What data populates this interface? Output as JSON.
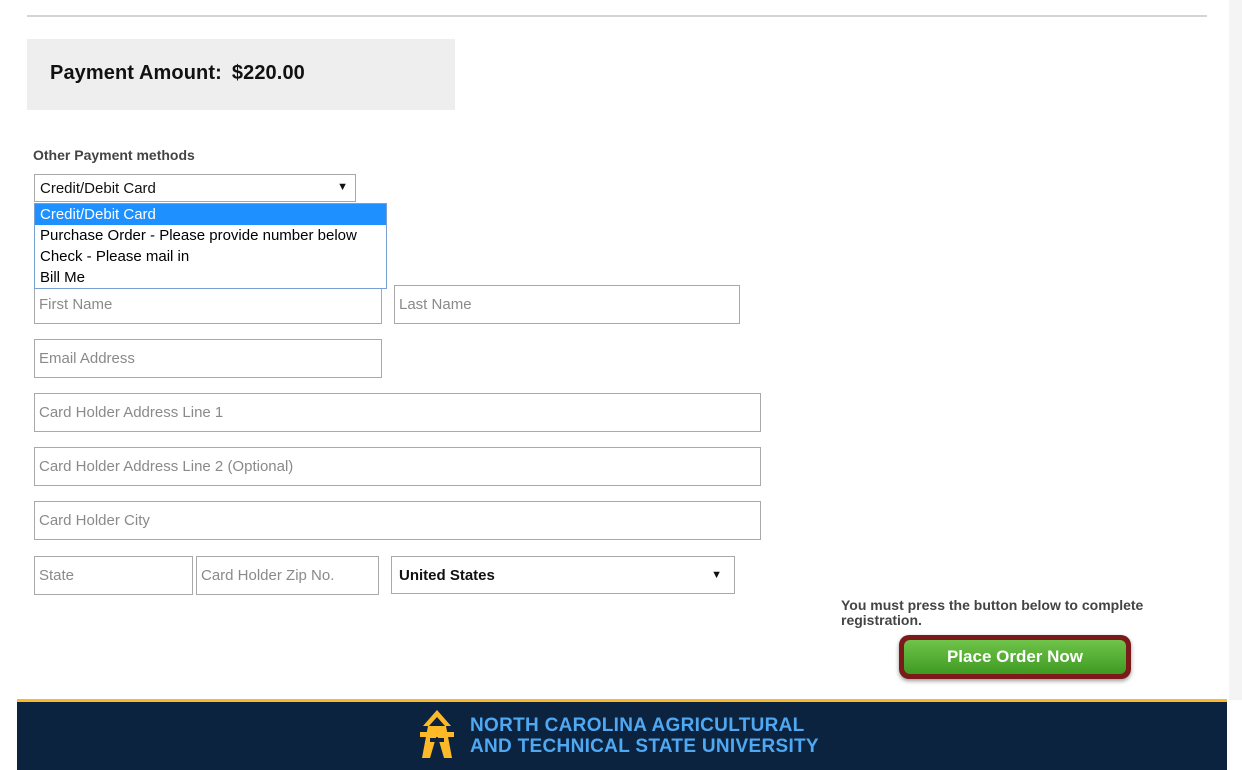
{
  "payment": {
    "label": "Payment Amount:",
    "amount": "$220.00"
  },
  "other_methods": {
    "label": "Other Payment methods",
    "selected": "Credit/Debit Card",
    "options": [
      "Credit/Debit Card",
      "Purchase Order - Please provide number below",
      "Check - Please mail in",
      "Bill Me"
    ]
  },
  "fields": {
    "first_name": "First Name",
    "last_name": "Last Name",
    "email": "Email Address",
    "address1": "Card Holder Address Line 1",
    "address2": "Card Holder Address Line 2 (Optional)",
    "city": "Card Holder City",
    "state": "State",
    "zip": "Card Holder Zip No.",
    "country": "United States"
  },
  "notice": "You must press the button below to complete registration.",
  "order_button": "Place Order Now",
  "footer": {
    "line1": "NORTH CAROLINA AGRICULTURAL",
    "line2": "AND TECHNICAL STATE UNIVERSITY"
  },
  "colors": {
    "accent_blue": "#1e90ff",
    "button_green": "#4caf2a",
    "footer_navy": "#0c2340",
    "footer_gold": "#fdb927"
  }
}
